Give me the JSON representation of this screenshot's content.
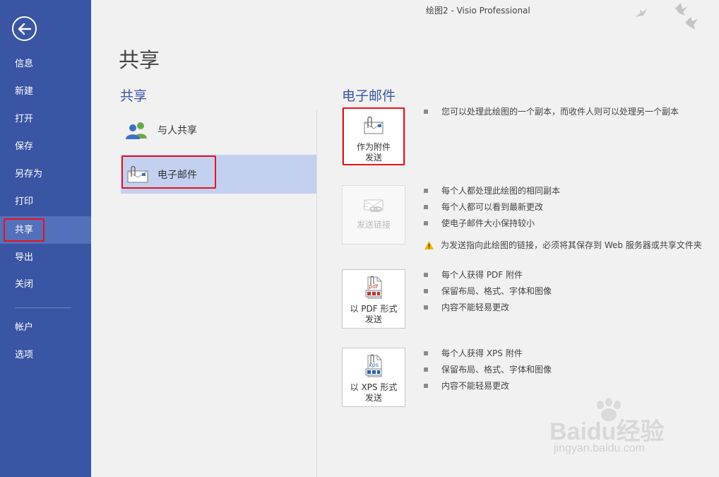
{
  "window": {
    "title": "绘图2 - Visio Professional"
  },
  "nav": {
    "back_icon": "arrow-left-icon",
    "items": [
      {
        "label": "信息"
      },
      {
        "label": "新建"
      },
      {
        "label": "打开"
      },
      {
        "label": "保存"
      },
      {
        "label": "另存为"
      },
      {
        "label": "打印"
      },
      {
        "label": "共享",
        "active": true
      },
      {
        "label": "导出"
      },
      {
        "label": "关闭"
      }
    ],
    "bottom_items": [
      {
        "label": "帐户"
      },
      {
        "label": "选项"
      }
    ]
  },
  "page": {
    "title": "共享"
  },
  "share": {
    "heading": "共享",
    "options": [
      {
        "label": "与人共享",
        "icon": "people-icon"
      },
      {
        "label": "电子邮件",
        "icon": "email-attachment-icon",
        "selected": true
      }
    ]
  },
  "email": {
    "heading": "电子邮件",
    "options": [
      {
        "label": "作为附件\n发送",
        "icon": "envelope-paperclip-icon",
        "bullets": [
          "您可以处理此绘图的一个副本，而收件人则可以处理另一个副本"
        ]
      },
      {
        "label": "发送链接",
        "icon": "envelope-link-icon",
        "disabled": true,
        "bullets": [
          "每个人都处理此绘图的相同副本",
          "每个人都可以看到最新更改",
          "使电子邮件大小保持较小"
        ],
        "warning": "为发送指向此绘图的链接，必须将其保存到 Web 服务器或共享文件夹"
      },
      {
        "label": "以 PDF 形式\n发送",
        "icon": "pdf-icon",
        "bullets": [
          "每个人获得 PDF 附件",
          "保留布局、格式、字体和图像",
          "内容不能轻易更改"
        ]
      },
      {
        "label": "以 XPS 形式\n发送",
        "icon": "xps-icon",
        "bullets": [
          "每个人获得 XPS 附件",
          "保留布局、格式、字体和图像",
          "内容不能轻易更改"
        ]
      }
    ]
  },
  "watermark": {
    "brand": "Baidu经验",
    "url": "jingyan.baidu.com"
  },
  "colors": {
    "nav_bg": "#3955a3",
    "nav_active": "#5470bb",
    "accent": "#3955a3",
    "selected_bg": "#c3d0f0",
    "highlight_red": "#e4141b"
  }
}
